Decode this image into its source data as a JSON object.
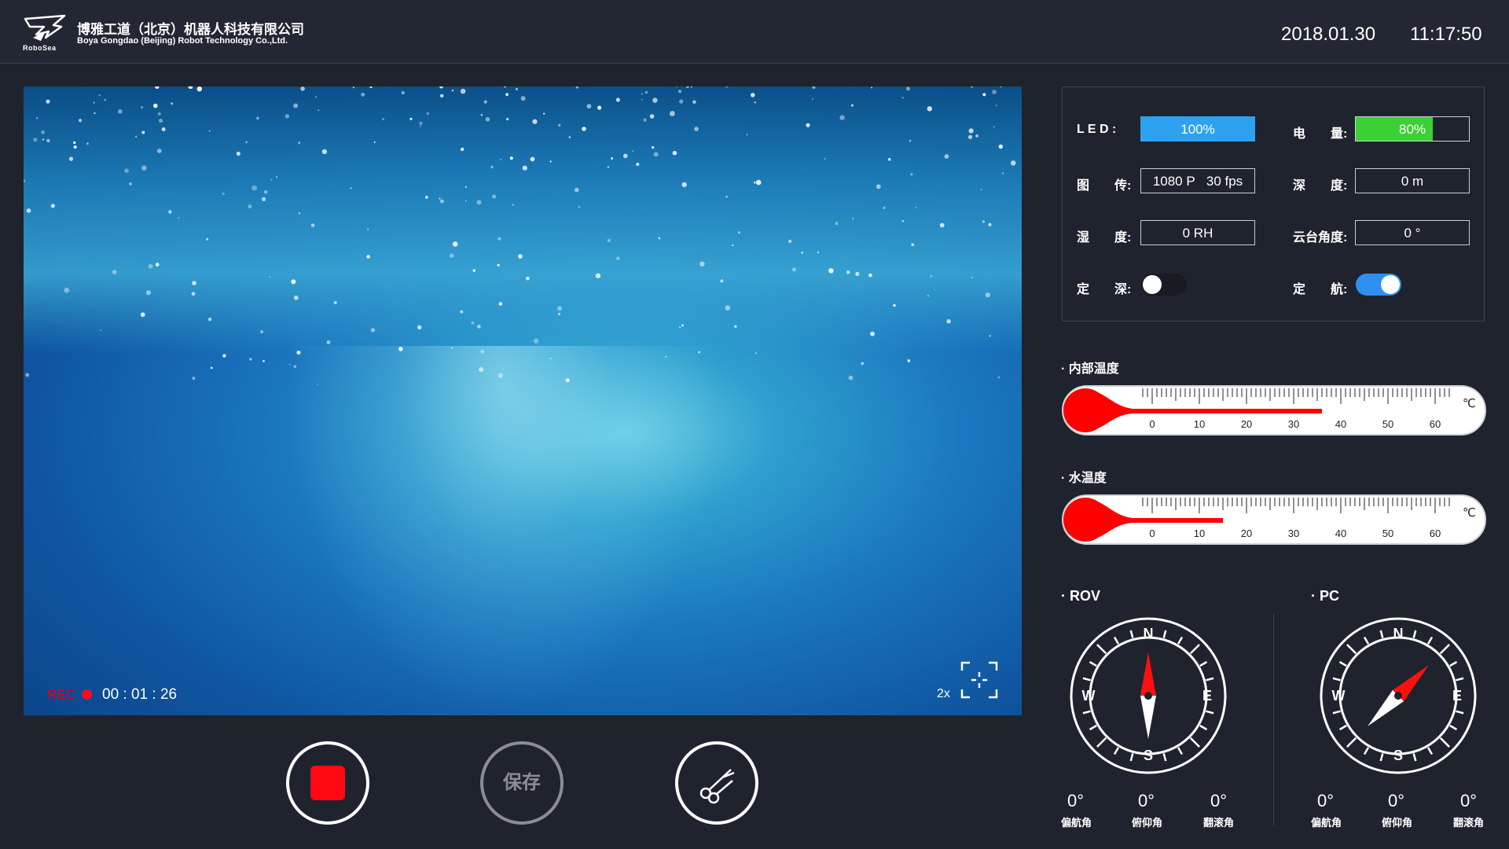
{
  "header": {
    "logo_text": "RoboSea",
    "company_cn": "博雅工道（北京）机器人科技有限公司",
    "company_en": "Boya Gongdao (Beijing) Robot Technology Co.,Ltd.",
    "date": "2018.01.30",
    "time": "11:17:50"
  },
  "video": {
    "rec_label": "REC",
    "rec_time": "00 : 01 : 26",
    "zoom": "2x"
  },
  "controls": {
    "save_label": "保存"
  },
  "status": {
    "led_label": "L E D :",
    "led_value": "100%",
    "led_level": 1.0,
    "battery_label": "电　　量:",
    "battery_value": "80%",
    "battery_level": 0.8,
    "stream_label": "图　　传:",
    "stream_res": "1080 P",
    "stream_fps": "30 fps",
    "depth_label": "深　　度:",
    "depth_value": "0 m",
    "humidity_label": "湿　　度:",
    "humidity_value": "0 RH",
    "gimbal_label": "云台角度:",
    "gimbal_value": "0 °",
    "depth_hold_label": "定　　深:",
    "depth_hold_on": false,
    "heading_hold_label": "定　　航:",
    "heading_hold_on": true
  },
  "temps": {
    "internal_title": "· 内部温度",
    "internal_value": 36,
    "water_title": "· 水温度",
    "water_value": 15,
    "unit": "℃",
    "ticks": [
      "0",
      "10",
      "20",
      "30",
      "40",
      "50",
      "60"
    ]
  },
  "compass": {
    "rov_title": "· ROV",
    "pc_title": "· PC",
    "n": "N",
    "e": "E",
    "s": "S",
    "w": "W",
    "rov_heading_deg": 0,
    "pc_heading_deg": 45,
    "rov_values": {
      "yaw": "0°",
      "pitch": "0°",
      "roll": "0°"
    },
    "pc_values": {
      "yaw": "0°",
      "pitch": "0°",
      "roll": "0°"
    },
    "labels": {
      "yaw": "偏航角",
      "pitch": "俯仰角",
      "roll": "翻滚角"
    }
  },
  "colors": {
    "background": "#1f232d",
    "led": "#2ea2f0",
    "battery": "#3bd134",
    "toggle_on": "#2f8ff0",
    "thermo": "#ff0000",
    "rec": "#ff0a1f"
  }
}
